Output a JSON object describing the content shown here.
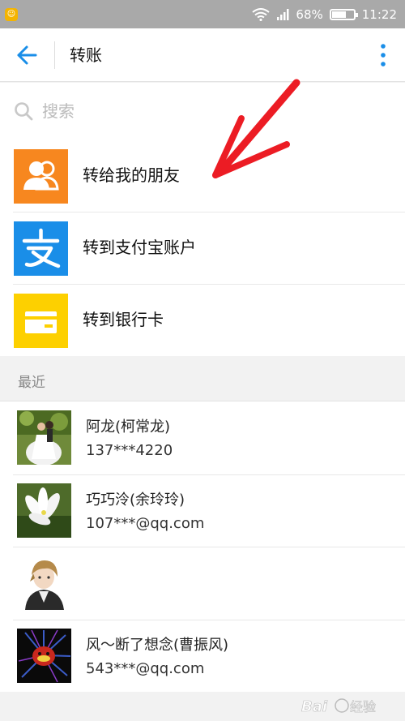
{
  "status_bar": {
    "battery_percent": "68%",
    "time": "11:22",
    "battery_level": 0.68
  },
  "header": {
    "title": "转账"
  },
  "search": {
    "placeholder": "搜索"
  },
  "options": [
    {
      "label": "转给我的朋友",
      "icon": "friends-icon",
      "color": "#f7871f"
    },
    {
      "label": "转到支付宝账户",
      "icon": "alipay-icon",
      "color": "#1a8ee8"
    },
    {
      "label": "转到银行卡",
      "icon": "bank-card-icon",
      "color": "#fdd000"
    }
  ],
  "recent": {
    "title": "最近",
    "contacts": [
      {
        "name": "阿龙(柯常龙)",
        "account": "137***4220",
        "avatar": "wedding-photo"
      },
      {
        "name": "巧巧泠(余玲玲)",
        "account": "107***@qq.com",
        "avatar": "white-flower"
      },
      {
        "name": "",
        "account": "",
        "avatar": "anime-boy"
      },
      {
        "name": "风～断了想念(曹振风)",
        "account": "543***@qq.com",
        "avatar": "red-figure-dark"
      }
    ]
  },
  "colors": {
    "accent_blue": "#1a8ee8",
    "annotation_red": "#ec1c24"
  }
}
